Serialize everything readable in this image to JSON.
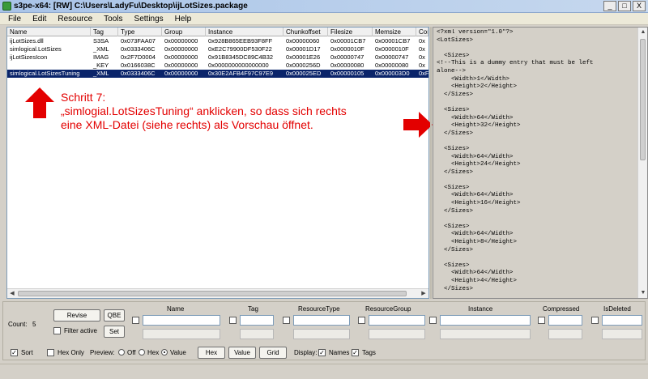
{
  "window": {
    "title": "s3pe-x64: [RW] C:\\Users\\LadyFu\\Desktop\\ijLotSizes.package",
    "minimize": "_",
    "maximize": "□",
    "close": "X"
  },
  "menu": [
    "File",
    "Edit",
    "Resource",
    "Tools",
    "Settings",
    "Help"
  ],
  "table": {
    "columns": [
      "Name",
      "Tag",
      "Type",
      "Group",
      "Instance",
      "Chunkoffset",
      "Filesize",
      "Memsize",
      "Cor"
    ],
    "rows": [
      [
        "ijLotSizes.dll",
        "S3SA",
        "0x073FAA07",
        "0x00000000",
        "0x928B865EEB93F8FF",
        "0x00000060",
        "0x00001CB7",
        "0x00001CB7",
        "0x"
      ],
      [
        "simlogical.LotSizes",
        "_XML",
        "0x0333406C",
        "0x00000000",
        "0xE2C79900DF530F22",
        "0x00001D17",
        "0x0000010F",
        "0x0000010F",
        "0x"
      ],
      [
        "ijLotSizesIcon",
        "IMAG",
        "0x2F7D0004",
        "0x00000000",
        "0x91B8345DC89C4B32",
        "0x00001E26",
        "0x00000747",
        "0x00000747",
        "0x"
      ],
      [
        "",
        "_KEY",
        "0x0166038C",
        "0x00000000",
        "0x0000000000000000",
        "0x0000256D",
        "0x00000080",
        "0x00000080",
        "0x"
      ],
      [
        "simlogical.LotSizesTuning",
        "_XML",
        "0x0333406C",
        "0x00000000",
        "0x30E2AFB4F97C97E9",
        "0x000025ED",
        "0x00000105",
        "0x000003D0",
        "0xF"
      ]
    ],
    "selected_row": 4
  },
  "annotation": {
    "line1": "Schritt 7:",
    "line2": "„simlogial.LotSizesTuning“ anklicken, so dass sich rechts",
    "line3": "eine XML-Datei (siehe rechts) als Vorschau öffnet.",
    "color": "#e30000"
  },
  "preview": {
    "lines": [
      "<?xml version=\"1.0\"?>",
      "<LotSizes>",
      "",
      "  <Sizes>",
      "<!--This is a dummy entry that must be left",
      "alone-->",
      "    <Width>1</Width>",
      "    <Height>2</Height>",
      "  </Sizes>",
      "",
      "  <Sizes>",
      "    <Width>64</Width>",
      "    <Height>32</Height>",
      "  </Sizes>",
      "",
      "  <Sizes>",
      "    <Width>64</Width>",
      "    <Height>24</Height>",
      "  </Sizes>",
      "",
      "  <Sizes>",
      "    <Width>64</Width>",
      "    <Height>16</Height>",
      "  </Sizes>",
      "",
      "  <Sizes>",
      "    <Width>64</Width>",
      "    <Height>8</Height>",
      "  </Sizes>",
      "",
      "  <Sizes>",
      "    <Width>64</Width>",
      "    <Height>4</Height>",
      "  </Sizes>"
    ]
  },
  "filter": {
    "count_label": "Count:",
    "count_value": "5",
    "revise_label": "Revise",
    "qbe_label": "QBE",
    "filter_active_label": "Filter active",
    "set_label": "Set",
    "field_headers": [
      "Name",
      "Tag",
      "ResourceType",
      "ResourceGroup",
      "Instance",
      "Compressed",
      "IsDeleted"
    ]
  },
  "options": {
    "sort_label": "Sort",
    "hexonly_label": "Hex Only",
    "preview_label": "Preview:",
    "off_label": "Off",
    "hex_label": "Hex",
    "value_label": "Value",
    "hex_btn": "Hex",
    "value_btn": "Value",
    "grid_btn": "Grid",
    "display_label": "Display:",
    "names_label": "Names",
    "tags_label": "Tags",
    "checkmark": "✓"
  }
}
